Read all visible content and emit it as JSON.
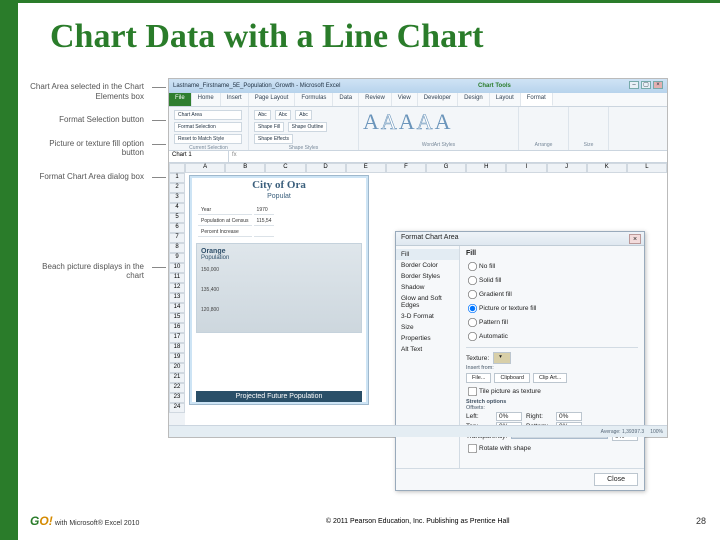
{
  "slide": {
    "title": "Chart Data with a Line Chart",
    "page_number": "28"
  },
  "footer": {
    "logo_g": "G",
    "logo_o": "O",
    "logo_ex": "!",
    "left_text": " with Microsoft® Excel 2010",
    "copyright": "© 2011 Pearson Education, Inc. Publishing as Prentice Hall"
  },
  "callouts": [
    "Chart Area selected in the Chart Elements box",
    "Format Selection button",
    "Picture or texture fill option button",
    "Format Chart Area dialog box",
    "Beach picture displays in the chart"
  ],
  "excel": {
    "window_title": "Lastname_Firstname_5E_Population_Growth - Microsoft Excel",
    "chart_tools": "Chart Tools",
    "tabs": {
      "file": "File",
      "home": "Home",
      "insert": "Insert",
      "page_layout": "Page Layout",
      "formulas": "Formulas",
      "data": "Data",
      "review": "Review",
      "view": "View",
      "developer": "Developer",
      "design": "Design",
      "layout": "Layout",
      "format": "Format"
    },
    "ribbon": {
      "chart_elements": "Chart Area",
      "format_selection": "Format Selection",
      "reset": "Reset to Match Style",
      "grp_sel": "Current Selection",
      "shape1": "Abc",
      "shape2": "Abc",
      "shape3": "Abc",
      "grp_styles": "Shape Styles",
      "shape_fill": "Shape Fill",
      "shape_outline": "Shape Outline",
      "shape_effects": "Shape Effects",
      "grp_word": "WordArt Styles",
      "grp_arr": "Arrange",
      "grp_size": "Size"
    },
    "namebox": "Chart 1",
    "cols": [
      "A",
      "B",
      "C",
      "D",
      "E",
      "F",
      "G",
      "H",
      "I",
      "J",
      "K",
      "L"
    ],
    "rows": [
      "1",
      "2",
      "3",
      "4",
      "5",
      "6",
      "7",
      "8",
      "9",
      "10",
      "11",
      "12",
      "13",
      "14",
      "15",
      "16",
      "17",
      "18",
      "19",
      "20",
      "21",
      "22",
      "23",
      "24"
    ],
    "chart": {
      "title": "City of Ora",
      "subtitle": "Populat",
      "table_r1c1": "Year",
      "table_r1c2": "1970",
      "table_r2c1": "Population at Census",
      "table_r2c2": "115,54",
      "table_r3c1": "Percent Increase",
      "inner_t1": "Orange",
      "inner_t2": "Population",
      "axis1": "150,000",
      "axis2": "135,400",
      "axis3": "120,800",
      "bottom_band": "Projected Future Population"
    },
    "status": {
      "avg": "Average: 1,39397.3",
      "zoom": "100%"
    }
  },
  "dialog": {
    "title": "Format Chart Area",
    "side": {
      "fill": "Fill",
      "border_color": "Border Color",
      "border_styles": "Border Styles",
      "shadow": "Shadow",
      "glow": "Glow and Soft Edges",
      "format3d": "3-D Format",
      "size": "Size",
      "properties": "Properties",
      "alt": "Alt Text"
    },
    "fill_section": "Fill",
    "radios": {
      "no_fill": "No fill",
      "solid": "Solid fill",
      "gradient": "Gradient fill",
      "picture": "Picture or texture fill",
      "pattern": "Pattern fill",
      "automatic": "Automatic"
    },
    "texture_label": "Texture:",
    "insert_from": "Insert from:",
    "btn_file": "File...",
    "btn_clipboard": "Clipboard",
    "btn_clipart": "Clip Art...",
    "tile_chk": "Tile picture as texture",
    "stretch_label": "Stretch options",
    "offsets_label": "Offsets:",
    "left": "Left:",
    "right": "Right:",
    "top": "Top:",
    "bottom": "Bottom:",
    "zero": "0%",
    "transparency": "Transparency:",
    "rotate_chk": "Rotate with shape",
    "close": "Close"
  }
}
